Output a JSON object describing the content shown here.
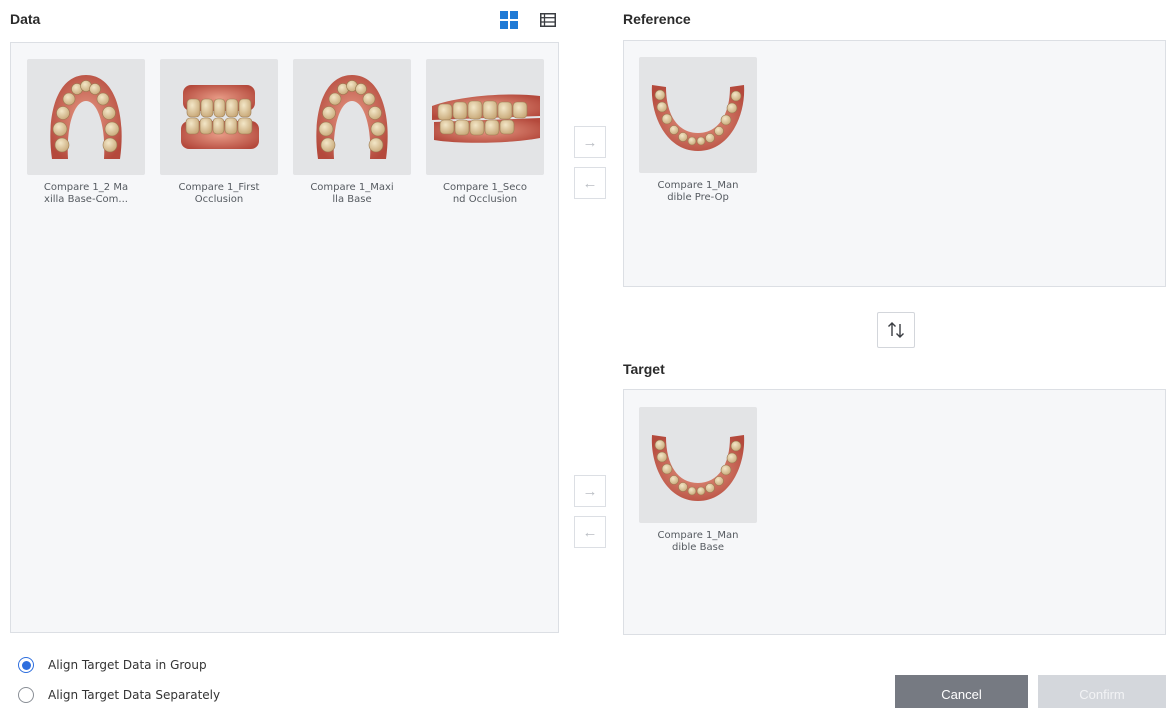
{
  "data_panel": {
    "title": "Data",
    "view_icons": {
      "grid": "grid-view-icon",
      "list": "list-view-icon",
      "active_color": "#1f7ad6"
    },
    "items": [
      {
        "label": "Compare 1_2 Ma\nxilla Base-Com...",
        "thumb": "upper-arch"
      },
      {
        "label": "Compare 1_First\nOcclusion",
        "thumb": "occlusion"
      },
      {
        "label": "Compare 1_Maxi\nlla Base",
        "thumb": "upper-arch"
      },
      {
        "label": "Compare 1_Seco\nnd Occlusion",
        "thumb": "occlusion-side"
      }
    ]
  },
  "reference_panel": {
    "title": "Reference",
    "items": [
      {
        "label": "Compare 1_Man\ndible Pre-Op",
        "thumb": "lower-arch"
      }
    ]
  },
  "target_panel": {
    "title": "Target",
    "items": [
      {
        "label": "Compare 1_Man\ndible Base",
        "thumb": "lower-arch"
      }
    ]
  },
  "transfer_buttons": {
    "right": "→",
    "left": "←"
  },
  "swap_icon": "swap-vertical-icon",
  "options": [
    {
      "label": "Align Target Data in Group",
      "checked": true
    },
    {
      "label": "Align Target Data Separately",
      "checked": false
    }
  ],
  "footer": {
    "cancel_label": "Cancel",
    "confirm_label": "Confirm"
  },
  "colors": {
    "accent": "#2f6fde",
    "cancel_bg": "#767a82",
    "confirm_disabled_bg": "#d4d7dc",
    "panel_bg": "#f6f7f9"
  }
}
